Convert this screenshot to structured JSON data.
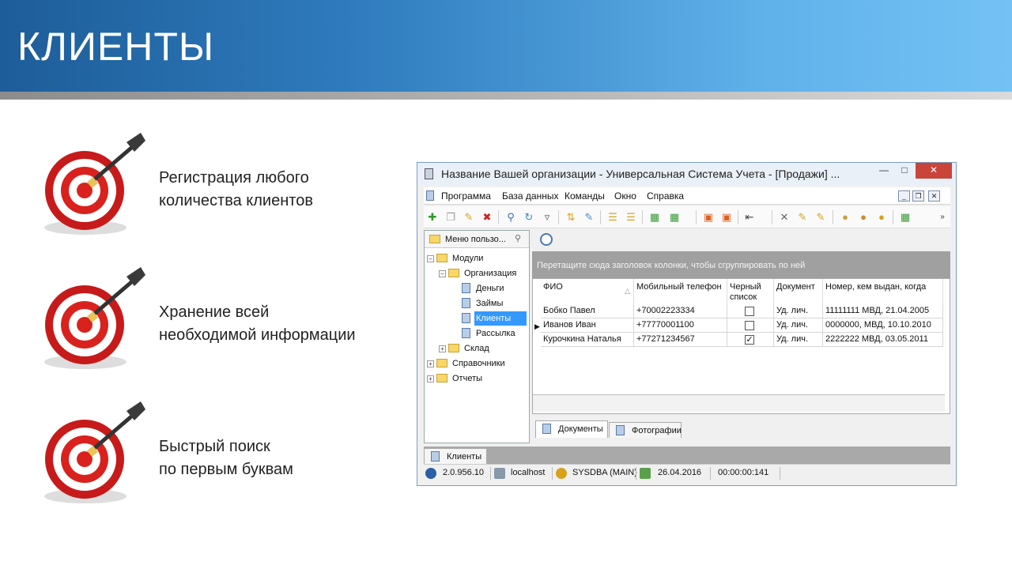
{
  "slide": {
    "title": "КЛИЕНТЫ"
  },
  "features": [
    {
      "line1": "Регистрация любого",
      "line2": "количества клиентов"
    },
    {
      "line1": "Хранение всей",
      "line2": "необходимой информации"
    },
    {
      "line1": "Быстрый поиск",
      "line2": "по первым буквам"
    }
  ],
  "window": {
    "title": "Название Вашей организации - Универсальная Система Учета - [Продажи] ...",
    "menu": [
      "Программа",
      "База данных",
      "Команды",
      "Окно",
      "Справка"
    ],
    "left_pane_title": "Меню пользо...",
    "tree": [
      {
        "label": "Модули"
      },
      {
        "label": "Организация"
      },
      {
        "label": "Деньги"
      },
      {
        "label": "Займы"
      },
      {
        "label": "Клиенты"
      },
      {
        "label": "Рассылка"
      },
      {
        "label": "Склад"
      },
      {
        "label": "Справочники"
      },
      {
        "label": "Отчеты"
      }
    ],
    "group_hint": "Перетащите сюда заголовок колонки, чтобы сгруппировать по ней",
    "columns": [
      "ФИО",
      "Мобильный телефон",
      "Черный список",
      "Документ",
      "Номер, кем выдан, когда"
    ],
    "rows": [
      {
        "name": "Бобко Павел",
        "phone": "+70002223334",
        "blacklist": false,
        "doc": "Уд. лич.",
        "number": "11111111 МВД, 21.04.2005"
      },
      {
        "name": "Иванов Иван",
        "phone": "+77770001100",
        "blacklist": false,
        "doc": "Уд. лич.",
        "number": "0000000, МВД, 10.10.2010"
      },
      {
        "name": "Курочкина Наталья",
        "phone": "+77271234567",
        "blacklist": true,
        "doc": "Уд. лич.",
        "number": "2222222 МВД, 03.05.2011"
      }
    ],
    "detail_tabs": [
      "Документы",
      "Фотографии"
    ],
    "bottom_tab": "Клиенты",
    "status": {
      "version": "2.0.956.10",
      "host": "localhost",
      "user": "SYSDBA (MAIN)",
      "date": "26.04.2016",
      "time": "00:00:00:141"
    }
  }
}
